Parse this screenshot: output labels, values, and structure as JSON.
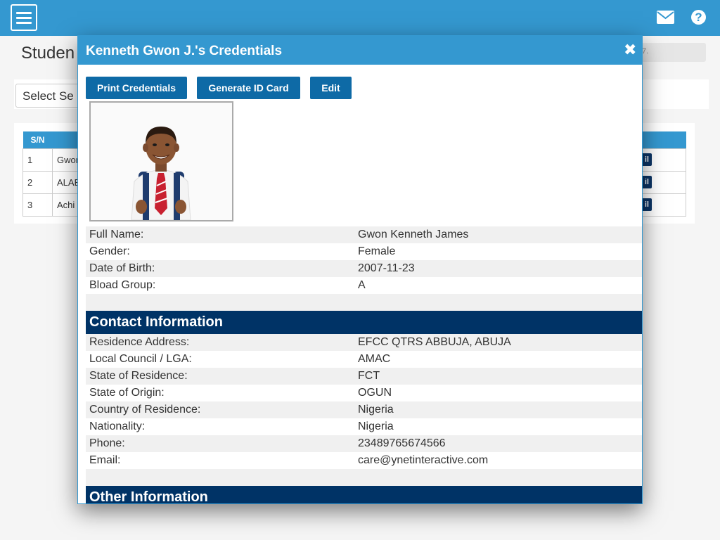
{
  "topbar": {
    "menu_icon": "hamburger-icon",
    "mail_icon": "envelope-icon",
    "help_icon": "question-circle-icon",
    "help_glyph": "?"
  },
  "background": {
    "page_title": "Studen",
    "breadcrumb": "7.",
    "select_label": "Select Se",
    "table": {
      "header_sn": "S/N",
      "rows": [
        {
          "sn": "1",
          "name": "Gwon"
        },
        {
          "sn": "2",
          "name": "ALAB"
        },
        {
          "sn": "3",
          "name": "Achi"
        }
      ],
      "detail_btn": "il"
    }
  },
  "modal": {
    "title": "Kenneth Gwon J.'s Credentials",
    "close_glyph": "✖",
    "buttons": {
      "print": "Print Credentials",
      "id_card": "Generate ID Card",
      "edit": "Edit"
    },
    "personal": [
      {
        "label": "Full Name:",
        "value": "Gwon Kenneth James"
      },
      {
        "label": "Gender:",
        "value": "Female"
      },
      {
        "label": "Date of Birth:",
        "value": "2007-11-23"
      },
      {
        "label": "Bload Group:",
        "value": "A"
      }
    ],
    "contact_heading": "Contact Information",
    "contact": [
      {
        "label": "Residence Address:",
        "value": "EFCC QTRS ABBUJA, ABUJA"
      },
      {
        "label": "Local Council / LGA:",
        "value": "AMAC"
      },
      {
        "label": "State of Residence:",
        "value": "FCT"
      },
      {
        "label": "State of Origin:",
        "value": "OGUN"
      },
      {
        "label": "Country of Residence:",
        "value": "Nigeria"
      },
      {
        "label": "Nationality:",
        "value": "Nigeria"
      },
      {
        "label": "Phone:",
        "value": "23489765674566"
      },
      {
        "label": "Email:",
        "value": "care@ynetinteractive.com"
      }
    ],
    "other_heading": "Other Information"
  },
  "colors": {
    "topbar": "#3498d0",
    "button": "#0e6aa6",
    "section_head": "#003366",
    "row_shade": "#f0f0f0"
  }
}
